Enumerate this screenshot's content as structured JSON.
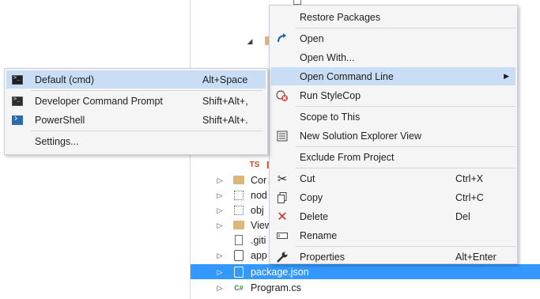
{
  "explorer": {
    "rows": [
      {
        "label": "",
        "icon": "ts-file-icon",
        "icon_text": "TS"
      },
      {
        "label": "Cor",
        "icon": "folder-icon"
      },
      {
        "label": "nod",
        "icon": "dotted-folder-icon"
      },
      {
        "label": "obj",
        "icon": "dotted-folder-icon"
      },
      {
        "label": "View",
        "icon": "folder-icon"
      },
      {
        "label": ".giti",
        "icon": "file-icon"
      },
      {
        "label": "app",
        "icon": "json-file-icon"
      },
      {
        "label": "package.json",
        "icon": "json-file-icon"
      },
      {
        "label": "Program.cs",
        "icon": "csharp-file-icon",
        "icon_text": "C#"
      }
    ],
    "selected_color": "#3399ff"
  },
  "context_menu": {
    "items": [
      {
        "label": "Restore Packages",
        "shortcut": "",
        "icon": ""
      },
      {
        "label": "Open",
        "shortcut": "",
        "icon": "open-arrow-icon"
      },
      {
        "label": "Open With...",
        "shortcut": "",
        "icon": ""
      },
      {
        "label": "Open Command Line",
        "shortcut": "",
        "icon": "",
        "submenu": true
      },
      {
        "label": "Run StyleCop",
        "shortcut": "",
        "icon": "stylecop-icon"
      },
      {
        "label": "Scope to This",
        "shortcut": "",
        "icon": ""
      },
      {
        "label": "New Solution Explorer View",
        "shortcut": "",
        "icon": "new-view-icon"
      },
      {
        "label": "Exclude From Project",
        "shortcut": "",
        "icon": ""
      },
      {
        "label": "Cut",
        "shortcut": "Ctrl+X",
        "icon": "scissors-icon"
      },
      {
        "label": "Copy",
        "shortcut": "Ctrl+C",
        "icon": "copy-icon"
      },
      {
        "label": "Delete",
        "shortcut": "Del",
        "icon": "delete-x-icon"
      },
      {
        "label": "Rename",
        "shortcut": "",
        "icon": "rename-icon"
      },
      {
        "label": "Properties",
        "shortcut": "Alt+Enter",
        "icon": "wrench-icon"
      }
    ],
    "hover_color": "#c9def5"
  },
  "submenu": {
    "items": [
      {
        "label": "Default (cmd)",
        "shortcut": "Alt+Space",
        "icon": "cmd-icon"
      },
      {
        "label": "Developer Command Prompt",
        "shortcut": "Shift+Alt+,",
        "icon": "dev-cmd-icon"
      },
      {
        "label": "PowerShell",
        "shortcut": "Shift+Alt+.",
        "icon": "powershell-icon"
      },
      {
        "label": "Settings...",
        "shortcut": "",
        "icon": ""
      }
    ]
  }
}
